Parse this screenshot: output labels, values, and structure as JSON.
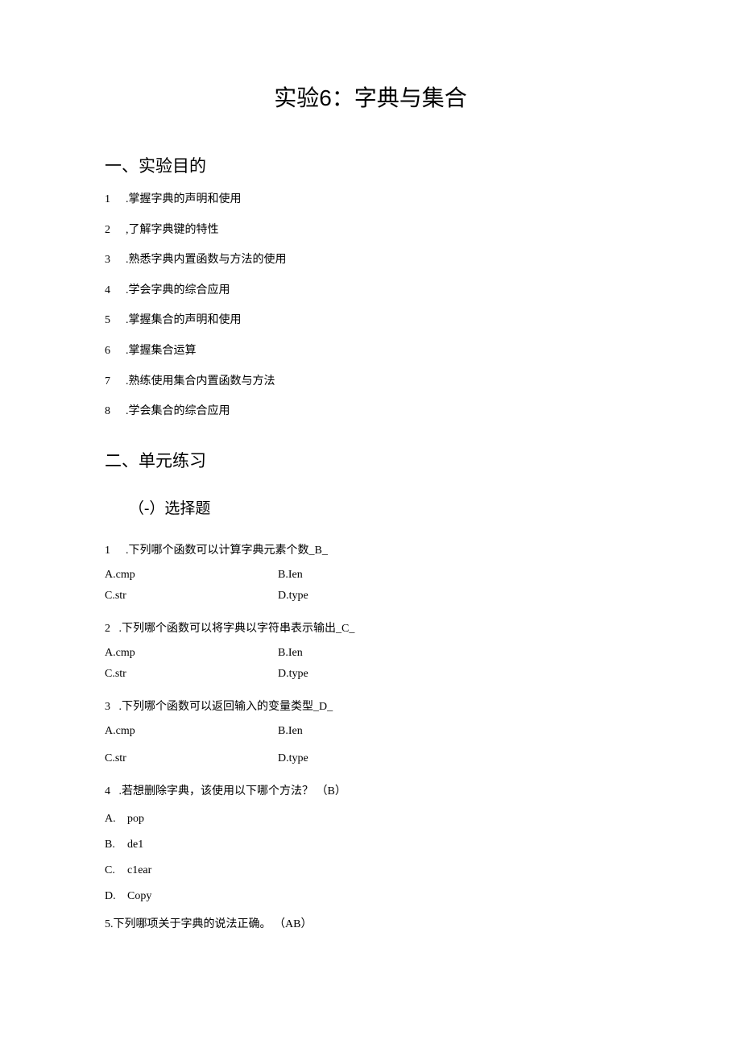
{
  "title_prefix": "实验",
  "title_num": "6",
  "title_suffix": "：字典与集合",
  "section1_heading": "一、实验目的",
  "objectives": [
    {
      "n": "1",
      "text": ".掌握字典的声明和使用"
    },
    {
      "n": "2",
      "text": ",了解字典键的特性"
    },
    {
      "n": "3",
      "text": ".熟悉字典内置函数与方法的使用"
    },
    {
      "n": "4",
      "text": ".学会字典的综合应用"
    },
    {
      "n": "5",
      "text": ".掌握集合的声明和使用"
    },
    {
      "n": "6",
      "text": ".掌握集合运算"
    },
    {
      "n": "7",
      "text": ".熟练使用集合内置函数与方法"
    },
    {
      "n": "8",
      "text": ".学会集合的综合应用"
    }
  ],
  "section2_heading": "二、单元练习",
  "subsection_heading": "（-）选择题",
  "q1": {
    "n": "1",
    "stem": ".下列哪个函数可以计算字典元素个数_B_",
    "a": "A.cmp",
    "b": "B.Ien",
    "c": "C.str",
    "d": "D.type"
  },
  "q2": {
    "n": "2",
    "stem": "  .下列哪个函数可以将字典以字符串表示输出_C_",
    "a": "A.cmp",
    "b": "B.Ien",
    "c": "C.str",
    "d": "D.type"
  },
  "q3": {
    "n": "3",
    "stem": "  .下列哪个函数可以返回输入的变量类型_D_",
    "a": "A.cmp",
    "b": "B.Ien",
    "c": "C.str",
    "d": "D.type"
  },
  "q4": {
    "n": "4",
    "stem": "  .若想删除字典，该使用以下哪个方法？  （B）",
    "a_letter": "A.",
    "a_text": "pop",
    "b_letter": "B.",
    "b_text": "de1",
    "c_letter": "C.",
    "c_text": "c1ear",
    "d_letter": "D.",
    "d_text": "Copy"
  },
  "q5": {
    "stem": "5.下列哪项关于字典的说法正确。 （AB）"
  }
}
